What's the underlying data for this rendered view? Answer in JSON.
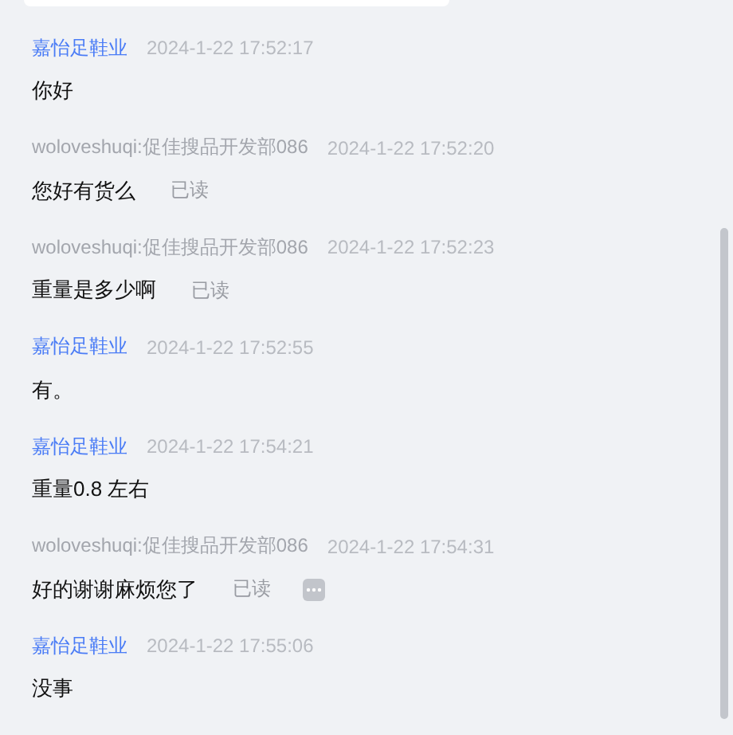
{
  "messages": [
    {
      "sender": "嘉怡足鞋业",
      "kind": "shop",
      "time": "2024-1-22 17:52:17",
      "text": "你好",
      "more": false
    },
    {
      "sender": "woloveshuqi:促佳搜品开发部086",
      "kind": "buyer",
      "time": "2024-1-22 17:52:20",
      "text": "您好有货么",
      "read_label": "已读",
      "more": false
    },
    {
      "sender": "woloveshuqi:促佳搜品开发部086",
      "kind": "buyer",
      "time": "2024-1-22 17:52:23",
      "text": "重量是多少啊",
      "read_label": "已读",
      "more": false
    },
    {
      "sender": "嘉怡足鞋业",
      "kind": "shop",
      "time": "2024-1-22 17:52:55",
      "text": "有。",
      "more": false
    },
    {
      "sender": "嘉怡足鞋业",
      "kind": "shop",
      "time": "2024-1-22 17:54:21",
      "text": "重量0.8 左右",
      "more": false
    },
    {
      "sender": "woloveshuqi:促佳搜品开发部086",
      "kind": "buyer",
      "time": "2024-1-22 17:54:31",
      "text": "好的谢谢麻烦您了",
      "read_label": "已读",
      "more": true
    },
    {
      "sender": "嘉怡足鞋业",
      "kind": "shop",
      "time": "2024-1-22 17:55:06",
      "text": "没事",
      "more": false
    }
  ]
}
